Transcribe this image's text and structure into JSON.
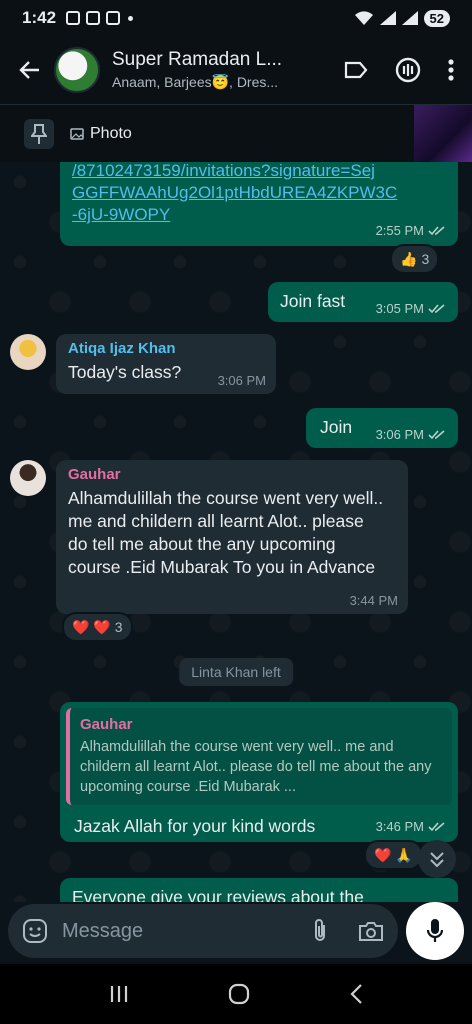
{
  "status": {
    "time": "1:42",
    "battery": "52"
  },
  "header": {
    "title": "Super Ramadan L...",
    "members": "Anaam, Barjees😇, Dres..."
  },
  "pinned": {
    "label": "Photo"
  },
  "messages": {
    "link": {
      "line1": "/87102473159/invitations?signature=Sej",
      "line2": "GGFFWAAhUg2Ol1ptHbdUREA4ZKPW3C",
      "line3": "-6jU-9WOPY",
      "time": "2:55 PM",
      "reaction_emoji": "👍",
      "reaction_count": "3"
    },
    "join_fast": {
      "text": "Join fast",
      "time": "3:05 PM"
    },
    "atiqa": {
      "sender": "Atiqa Ijaz Khan",
      "text": "Today's class?",
      "time": "3:06 PM",
      "sender_color": "#53bdeb"
    },
    "join": {
      "text": "Join",
      "time": "3:06 PM"
    },
    "gauhar": {
      "sender": "Gauhar",
      "text": "Alhamdulillah the course went very well.. me and childern all learnt Alot.. please do tell me about the any upcoming course .Eid Mubarak To you in Advance",
      "time": "3:44 PM",
      "sender_color": "#e26fa1",
      "reaction_emoji": "❤️ ❤️",
      "reaction_count": "3"
    },
    "system": "Linta Khan left",
    "reply": {
      "quote_name": "Gauhar",
      "quote_text": "Alhamdulillah the course went very well.. me and childern all learnt Alot.. please do tell me about the any upcoming course .Eid Mubarak ...",
      "text": "Jazak Allah for your kind words",
      "time": "3:46 PM",
      "reaction_emoji": "❤️ 🙏"
    },
    "partial": "Everyone give your reviews about the"
  },
  "composer": {
    "placeholder": "Message"
  },
  "colors": {
    "outgoing": "#005c4b",
    "incoming": "#1f2c34",
    "accent": "#00a884",
    "link": "#53bdeb"
  }
}
